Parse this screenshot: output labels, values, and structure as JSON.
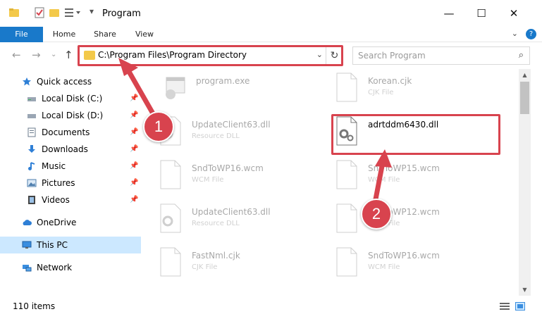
{
  "window": {
    "title": "Program",
    "minimize": "—",
    "maximize": "☐",
    "close": "✕"
  },
  "ribbon": {
    "tabs": [
      "File",
      "Home",
      "Share",
      "View"
    ],
    "help": "?"
  },
  "address": {
    "path": "C:\\Program Files\\Program Directory",
    "refresh": "↻"
  },
  "search": {
    "placeholder": "Search Program"
  },
  "nav": {
    "items": [
      {
        "label": "Quick access",
        "icon": "star-icon"
      },
      {
        "label": "Local Disk (C:)",
        "icon": "drive-icon"
      },
      {
        "label": "Local Disk (D:)",
        "icon": "drive-icon"
      },
      {
        "label": "Documents",
        "icon": "document-icon"
      },
      {
        "label": "Downloads",
        "icon": "download-icon"
      },
      {
        "label": "Music",
        "icon": "music-icon"
      },
      {
        "label": "Pictures",
        "icon": "picture-icon"
      },
      {
        "label": "Videos",
        "icon": "video-icon"
      },
      {
        "label": "OneDrive",
        "icon": "cloud-icon"
      },
      {
        "label": "This PC",
        "icon": "computer-icon"
      },
      {
        "label": "Network",
        "icon": "network-icon"
      }
    ]
  },
  "files": [
    {
      "name": "program.exe",
      "type": ""
    },
    {
      "name": "Korean.cjk",
      "type": "CJK File"
    },
    {
      "name": "UpdateClient63.dll",
      "type": "Resource DLL"
    },
    {
      "name": "adrtddm6430.dll",
      "type": ""
    },
    {
      "name": "SndToWP16.wcm",
      "type": "WCM File"
    },
    {
      "name": "SndToWP15.wcm",
      "type": "WCM File"
    },
    {
      "name": "UpdateClient63.dll",
      "type": "Resource DLL"
    },
    {
      "name": "SndToWP12.wcm",
      "type": "WCM File"
    },
    {
      "name": "FastNml.cjk",
      "type": "CJK File"
    },
    {
      "name": "SndToWP16.wcm",
      "type": "WCM File"
    }
  ],
  "status": {
    "count": "110 items"
  },
  "markers": {
    "first": "1",
    "second": "2"
  },
  "colors": {
    "accent": "#1979ca",
    "annotation": "#d8434e",
    "selection": "#cce8ff"
  }
}
